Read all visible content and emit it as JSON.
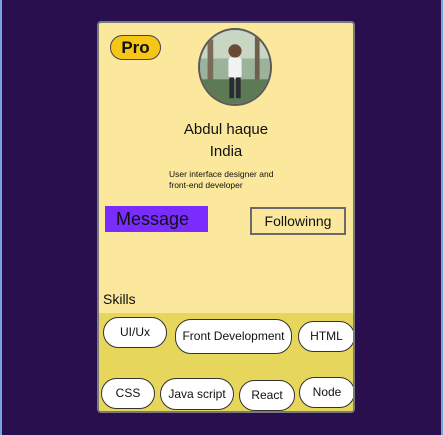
{
  "profile": {
    "badge": "Pro",
    "name": "Abdul haque",
    "country": "India",
    "bio": "User interface designer and\nfront-end developer",
    "avatar_icon": "profile-photo"
  },
  "actions": {
    "message_label": "Message",
    "following_label": "Followinng"
  },
  "skills": {
    "title": "Skills",
    "items": [
      "UI/Ux",
      "Front Development",
      "HTML",
      "CSS",
      "Java script",
      "React",
      "Node"
    ]
  },
  "colors": {
    "background": "#2a0f4e",
    "card": "#fbe89c",
    "skills_area": "#e6d75c",
    "badge": "#f5c518",
    "message_button": "#7a2cff"
  }
}
